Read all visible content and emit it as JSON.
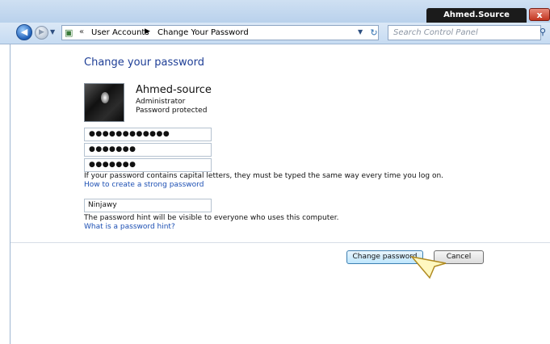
{
  "titlebar": {
    "user_tab": "Ahmed.Source",
    "close_glyph": "x"
  },
  "nav": {
    "breadcrumb": [
      "User Accounts",
      "Change Your Password"
    ],
    "breadcrumb_prefix": "«",
    "search_placeholder": "Search Control Panel"
  },
  "main": {
    "heading": "Change your password",
    "user": {
      "name": "Ahmed-source",
      "role": "Administrator",
      "status": "Password protected"
    },
    "fields": {
      "current_password": "●●●●●●●●●●●●",
      "new_password": "●●●●●●●",
      "confirm_password": "●●●●●●●",
      "password_hint": "Ninjawy"
    },
    "case_note": "If your password contains capital letters, they must be typed the same way every time you log on.",
    "strong_password_link": "How to create a strong password",
    "hint_note": "The password hint will be visible to everyone who uses this computer.",
    "hint_link": "What is a password hint?"
  },
  "buttons": {
    "change": "Change password",
    "cancel": "Cancel"
  },
  "icons": [
    "back-arrow-icon",
    "forward-arrow-icon",
    "control-panel-icon",
    "refresh-icon",
    "search-icon",
    "close-icon",
    "mouse-cursor-icon"
  ]
}
